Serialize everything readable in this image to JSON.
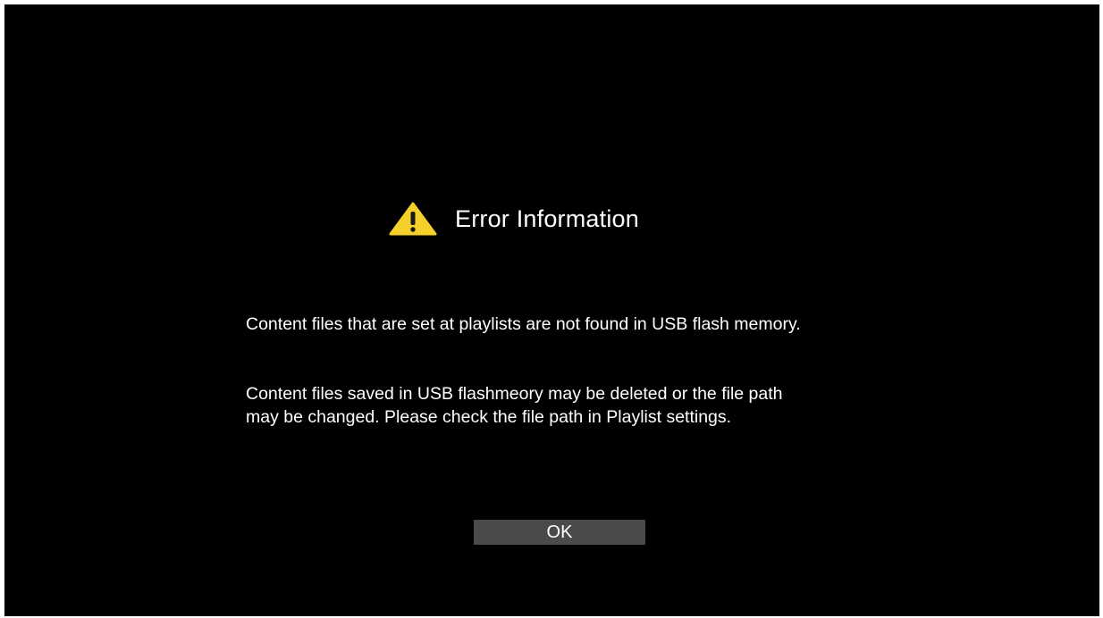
{
  "dialog": {
    "icon": "warning-icon",
    "title": "Error Information",
    "message_line1": "Content files that are set at playlists are not found in USB flash memory.",
    "message_line2": "Content files saved in USB flashmeory may be deleted or the file path",
    "message_line3": "may be changed. Please check the file path in Playlist settings.",
    "ok_label": "OK"
  },
  "colors": {
    "background": "#000000",
    "text": "#ffffff",
    "warning": "#f5cf2a",
    "button": "#4a4a4a"
  }
}
